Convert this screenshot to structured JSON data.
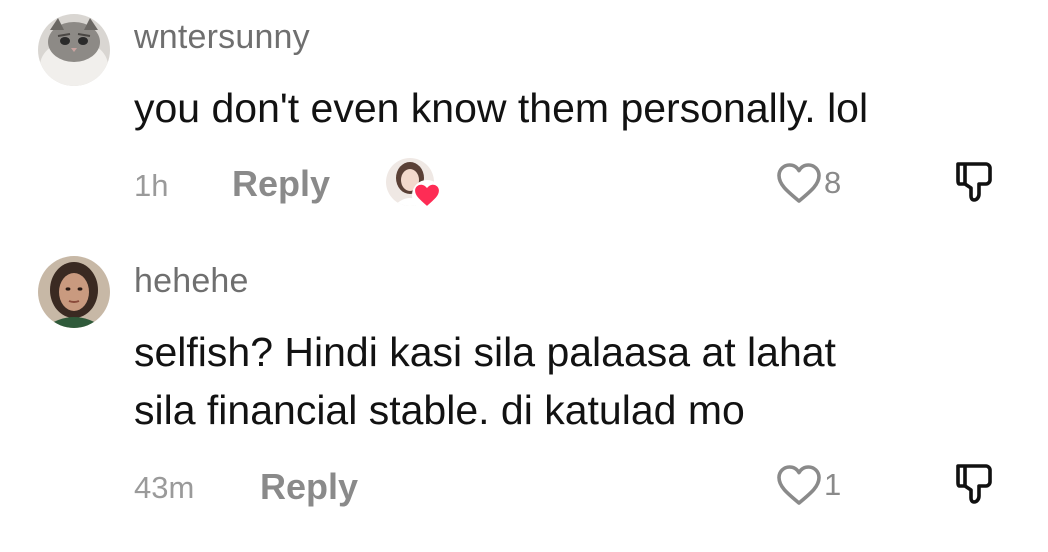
{
  "comments": [
    {
      "username": "wntersunny",
      "avatar_icon": "cat-avatar-icon",
      "text_lines": [
        "you don't even know them personally. lol"
      ],
      "time": "1h",
      "reply_label": "Reply",
      "liked_by_creator": true,
      "like_count": "8"
    },
    {
      "username": "hehehe",
      "avatar_icon": "person-avatar-icon",
      "text_lines": [
        "selfish? Hindi kasi sila palaasa at lahat",
        "sila financial stable. di katulad mo"
      ],
      "time": "43m",
      "reply_label": "Reply",
      "liked_by_creator": false,
      "like_count": "1"
    }
  ],
  "colors": {
    "heart_red": "#fe2c55",
    "secondary_text": "#8a8a8a",
    "primary_text": "#121212"
  }
}
